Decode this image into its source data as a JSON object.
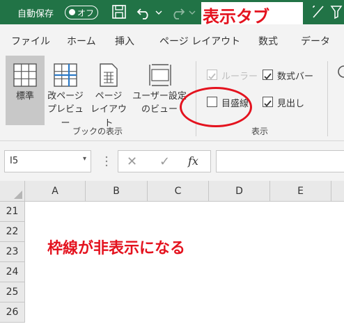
{
  "titlebar": {
    "autosave_label": "自動保存",
    "toggle_state": "オフ",
    "annotation": "表示タブ",
    "accent_color": "#217346",
    "annotation_color": "#e4121e"
  },
  "menu": {
    "items": [
      "ファイル",
      "ホーム",
      "挿入",
      "ページ レイアウト",
      "数式",
      "データ"
    ]
  },
  "ribbon": {
    "workbook_views": {
      "normal": "標準",
      "page_break_line1": "改ページ",
      "page_break_line2": "プレビュー",
      "page_layout_line1": "ページ",
      "page_layout_line2": "レイアウト",
      "custom_line1": "ユーザー設定",
      "custom_line2": "のビュー",
      "group_label": "ブックの表示"
    },
    "show": {
      "ruler": "ルーラー",
      "formula_bar": "数式バー",
      "gridlines": "目盛線",
      "headings": "見出し",
      "group_label": "表示"
    }
  },
  "formula_bar": {
    "name_box": "I5",
    "cancel": "✕",
    "enter": "✓",
    "function": "fx"
  },
  "grid": {
    "columns": [
      "A",
      "B",
      "C",
      "D",
      "E"
    ],
    "rows": [
      "21",
      "22",
      "23",
      "24",
      "25",
      "26"
    ],
    "annotation": "枠線が非表示になる"
  }
}
